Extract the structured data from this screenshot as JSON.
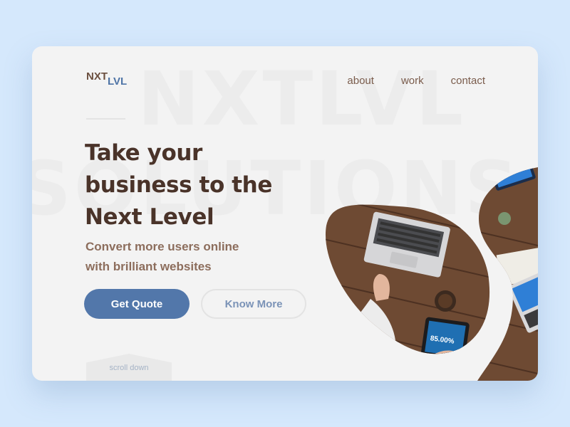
{
  "logo": {
    "main": "NXT",
    "sub": "LVL"
  },
  "background_text": {
    "line1": "NXTLVL",
    "line2": "SOLUTIONS"
  },
  "nav": {
    "items": [
      "about",
      "work",
      "contact"
    ]
  },
  "hero": {
    "headline": [
      "Take your",
      "business to the",
      "Next Level"
    ],
    "subheadline": [
      "Convert more users online",
      "with brilliant websites"
    ],
    "primary_button": "Get Quote",
    "secondary_button": "Know More"
  },
  "scroll": {
    "label": "scroll down"
  },
  "photo": {
    "screen_text": "85.00%",
    "icon": "office-desk-photo"
  },
  "colors": {
    "page_bg": "#d5e8fc",
    "card_bg": "#f3f3f3",
    "brand_brown": "#4a3329",
    "accent_blue": "#5277aa"
  }
}
